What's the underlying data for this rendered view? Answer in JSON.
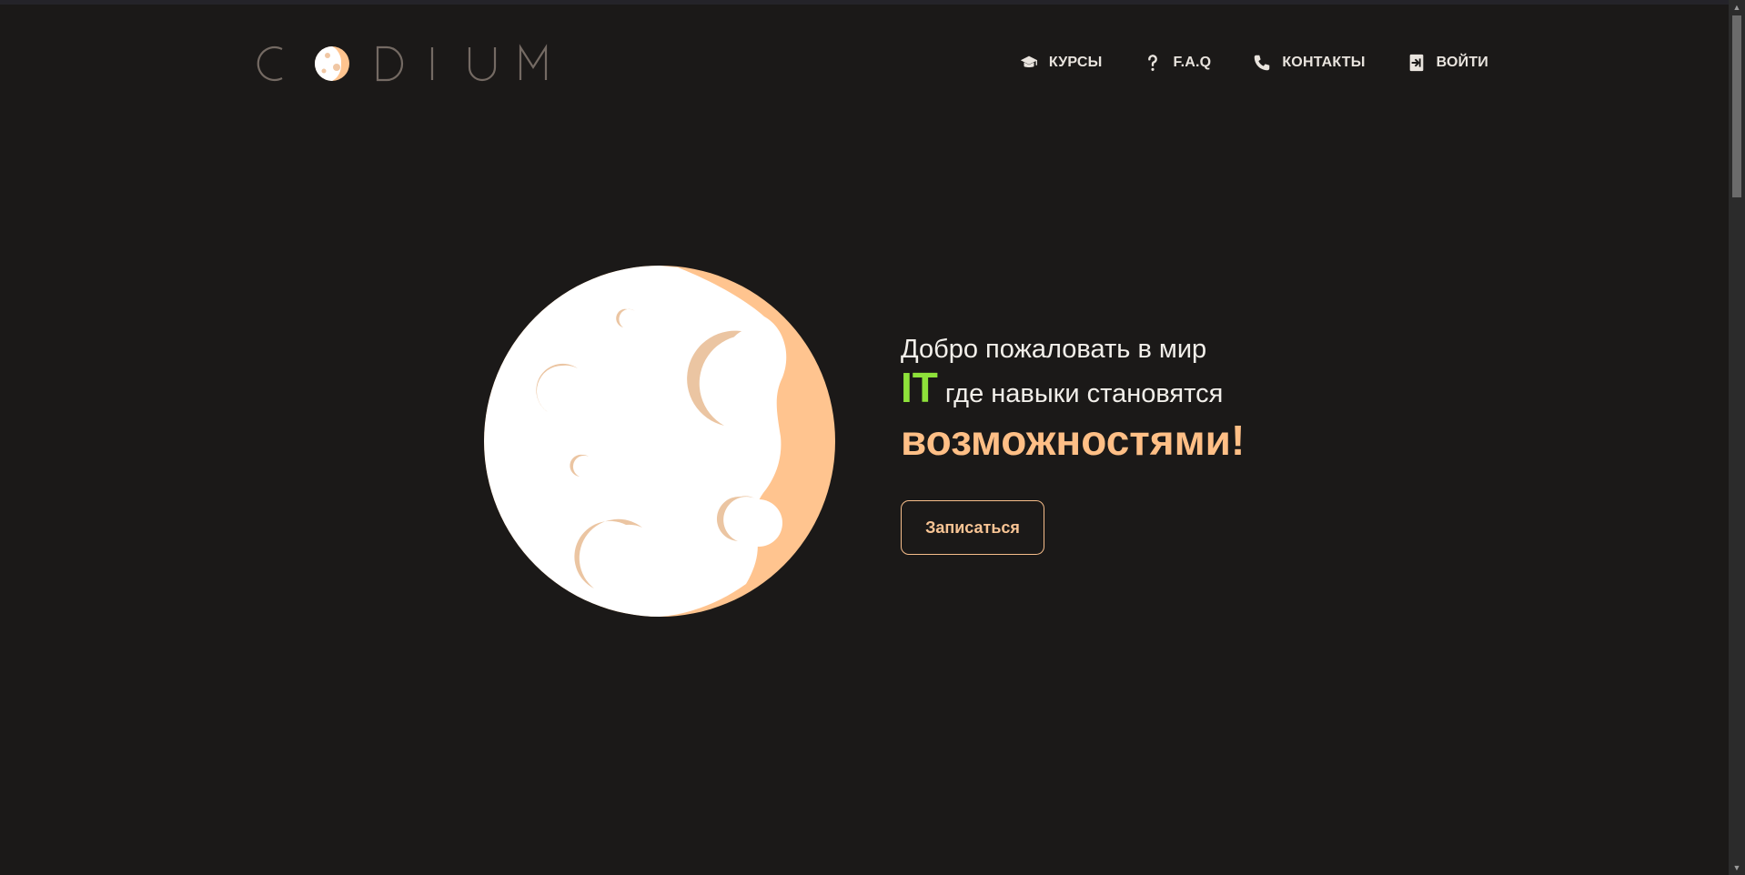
{
  "brand": {
    "name": "CODIUM",
    "colors": {
      "logo_letters": "#746a63",
      "accent": "#ffbf86",
      "green": "#8ee23a",
      "background": "#1b1918"
    }
  },
  "nav": {
    "items": [
      {
        "label": "КУРСЫ",
        "icon": "graduation-cap-icon"
      },
      {
        "label": "F.A.Q",
        "icon": "question-mark-icon"
      },
      {
        "label": "КОНТАКТЫ",
        "icon": "phone-icon"
      },
      {
        "label": "ВОЙТИ",
        "icon": "sign-in-icon"
      }
    ]
  },
  "hero": {
    "line1": "Добро пожаловать в мир",
    "it": "IT",
    "line2_rest": "где навыки становятся",
    "line3": "возможностями!",
    "button": "Записаться"
  },
  "scrollbar": {
    "up_arrow": "▲",
    "down_arrow": "▼"
  }
}
